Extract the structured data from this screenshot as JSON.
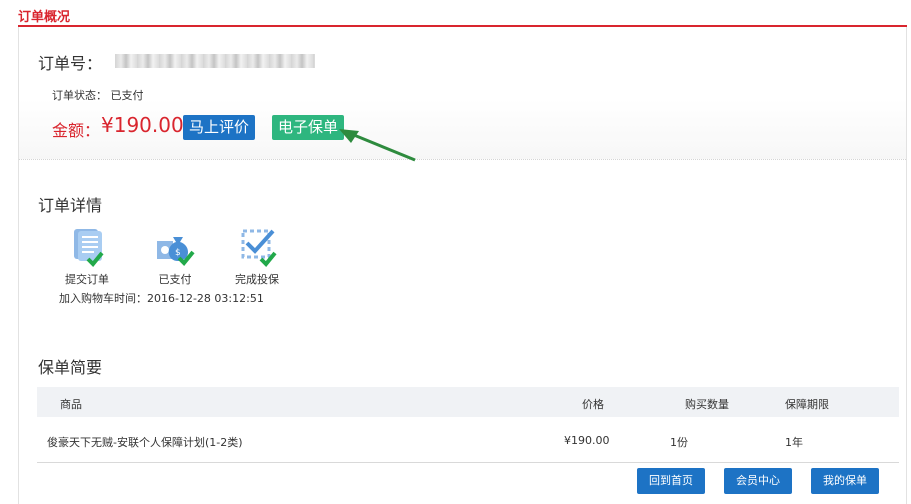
{
  "section_title": "订单概况",
  "summary": {
    "order_no_label": "订单号：",
    "status_label": "订单状态： 已支付",
    "amount_label": "金额：",
    "amount_value": "¥190.00",
    "review_button": "马上评价",
    "policy_button": "电子保单"
  },
  "details": {
    "title": "订单详情",
    "steps": [
      {
        "label": "提交订单",
        "icon": "order-list-icon"
      },
      {
        "label": "已支付",
        "icon": "money-bag-icon"
      },
      {
        "label": "完成投保",
        "icon": "check-square-icon"
      }
    ],
    "cart_time": "加入购物车时间：2016-12-28 03:12:51"
  },
  "brief": {
    "title": "保单简要",
    "columns": [
      "商品",
      "价格",
      "购买数量",
      "保障期限"
    ],
    "rows": [
      [
        "俊豪天下无贼-安联个人保障计划(1-2类)",
        "¥190.00",
        "1份",
        "1年"
      ]
    ]
  },
  "actions": {
    "home": "回到首页",
    "member_center": "会员中心",
    "my_policies": "我的保单"
  },
  "colors": {
    "accent_red": "#d9252e",
    "primary_blue": "#1d73c5",
    "policy_green": "#2eb67f",
    "check_green": "#22a94a"
  }
}
